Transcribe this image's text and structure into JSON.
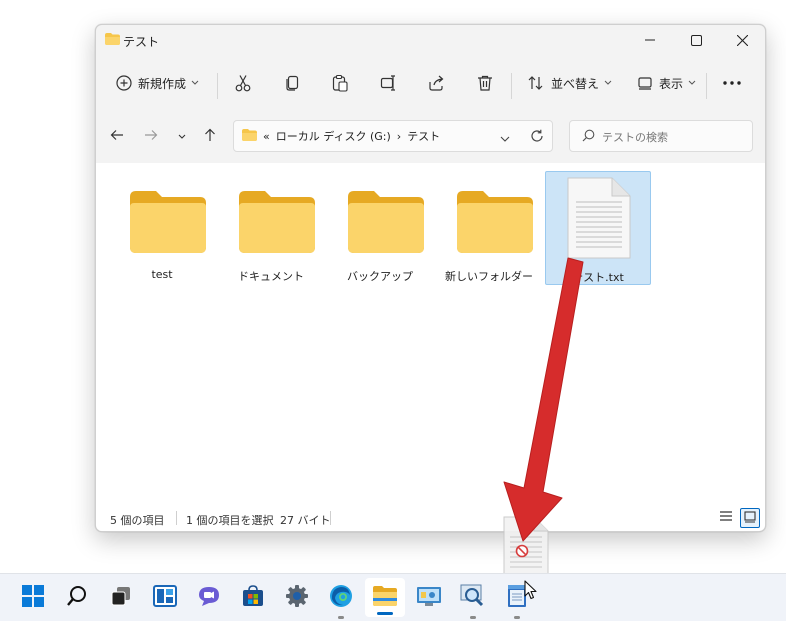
{
  "window": {
    "title": "テスト",
    "controls": {
      "minimize": "minimize",
      "maximize": "maximize",
      "close": "close"
    }
  },
  "toolbar": {
    "new_label": "新規作成",
    "sort_label": "並べ替え",
    "view_label": "表示",
    "more": "…"
  },
  "address": {
    "prefix": "«",
    "drive": "ローカル ディスク (G:)",
    "separator": "›",
    "folder": "テスト"
  },
  "search": {
    "placeholder": "テストの検索"
  },
  "items": [
    {
      "label": "test",
      "type": "folder"
    },
    {
      "label": "ドキュメント",
      "type": "folder"
    },
    {
      "label": "バックアップ",
      "type": "folder"
    },
    {
      "label": "新しいフォルダー",
      "type": "folder"
    },
    {
      "label": "テスト.txt",
      "type": "text-file",
      "selected": true
    }
  ],
  "status": {
    "count": "5 個の項目",
    "selection": "1 個の項目を選択",
    "size": "27 バイト"
  },
  "colors": {
    "accent": "#0067c0",
    "folder": "#f6c64a",
    "selection": "#cce4f7",
    "arrow": "#d62c2c"
  },
  "taskbar": {
    "icons": [
      "start-icon",
      "search-icon",
      "task-view-icon",
      "widgets-icon",
      "chat-icon",
      "store-icon",
      "settings-icon",
      "edge-icon",
      "file-explorer-icon",
      "control-panel-icon",
      "magnifier-icon",
      "notepad-icon"
    ]
  }
}
